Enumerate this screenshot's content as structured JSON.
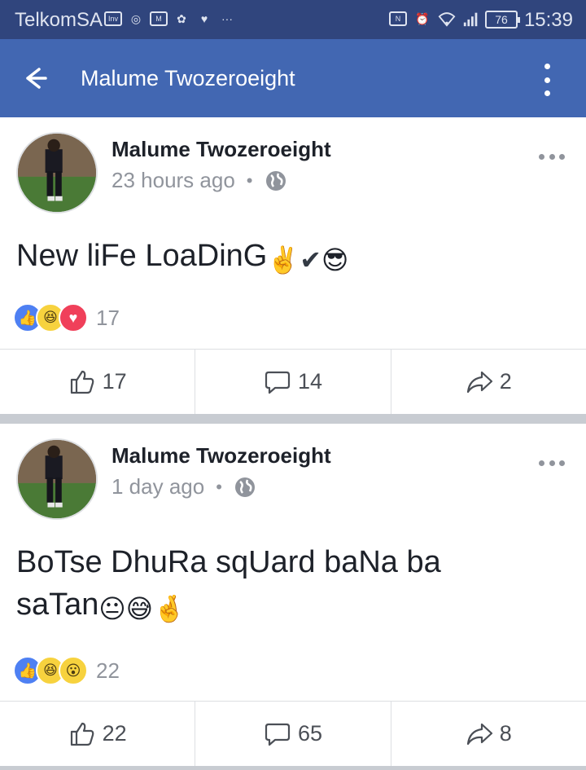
{
  "status_bar": {
    "carrier": "TelkomSA",
    "left_icons": [
      "investing-icon",
      "chrome-icon",
      "gmail-icon",
      "cnbc-icon",
      "messenger-icon",
      "more-notifications-icon"
    ],
    "right_icons": [
      "nfc-icon",
      "alarm-icon",
      "wifi-icon",
      "signal-icon"
    ],
    "battery": "76",
    "time": "15:39",
    "color": "#30457d"
  },
  "app_bar": {
    "title": "Malume Twozeroeight",
    "color": "#4267b2"
  },
  "posts": [
    {
      "author": "Malume Twozeroeight",
      "time": "23 hours ago",
      "privacy_icon": "globe-icon",
      "text": "New liFe LoaDinG",
      "emojis": [
        "✌️",
        "✔",
        "😎"
      ],
      "reactions": [
        "like",
        "haha",
        "love"
      ],
      "reaction_count": "17",
      "actions": {
        "like": "17",
        "comment": "14",
        "share": "2"
      }
    },
    {
      "author": "Malume Twozeroeight",
      "time": "1 day ago",
      "privacy_icon": "globe-icon",
      "text_line1": "BoTse DhuRa sqUard baNa ba",
      "text_line2": "saTan",
      "emojis": [
        "😐",
        "😅",
        "🤞"
      ],
      "reactions": [
        "like",
        "haha",
        "wow"
      ],
      "reaction_count": "22",
      "actions": {
        "like": "22",
        "comment": "65",
        "share": "8"
      }
    }
  ]
}
